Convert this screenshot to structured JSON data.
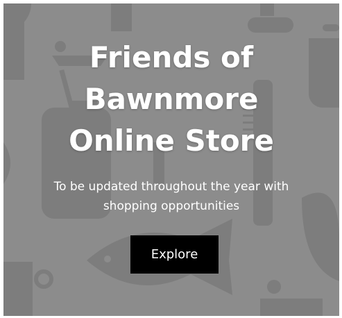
{
  "hero": {
    "title_line_1": "Friends of",
    "title_line_2": "Bawnmore",
    "title_line_3": "Online Store",
    "subtitle_line_1": "To be updated throughout the year with",
    "subtitle_line_2": "shopping opportunities",
    "button_label": "Explore"
  },
  "colors": {
    "background": "#8c8c8c",
    "shapes": "#7a7a7a",
    "button": "#000000",
    "text": "#ffffff"
  }
}
